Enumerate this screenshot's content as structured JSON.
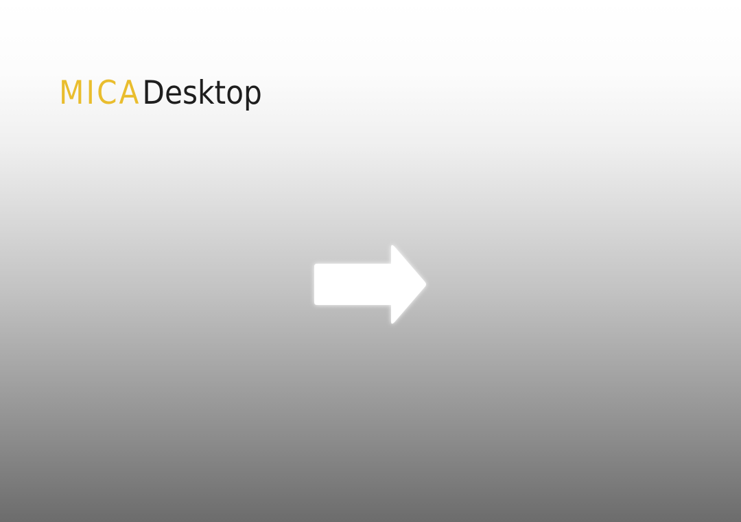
{
  "logo": {
    "primary": "MICA",
    "secondary": "Desktop",
    "primary_color": "#e9bd2e",
    "secondary_color": "#1e1e1e"
  },
  "continue_button": {
    "icon": "arrow-right-icon",
    "color": "#ffffff"
  }
}
